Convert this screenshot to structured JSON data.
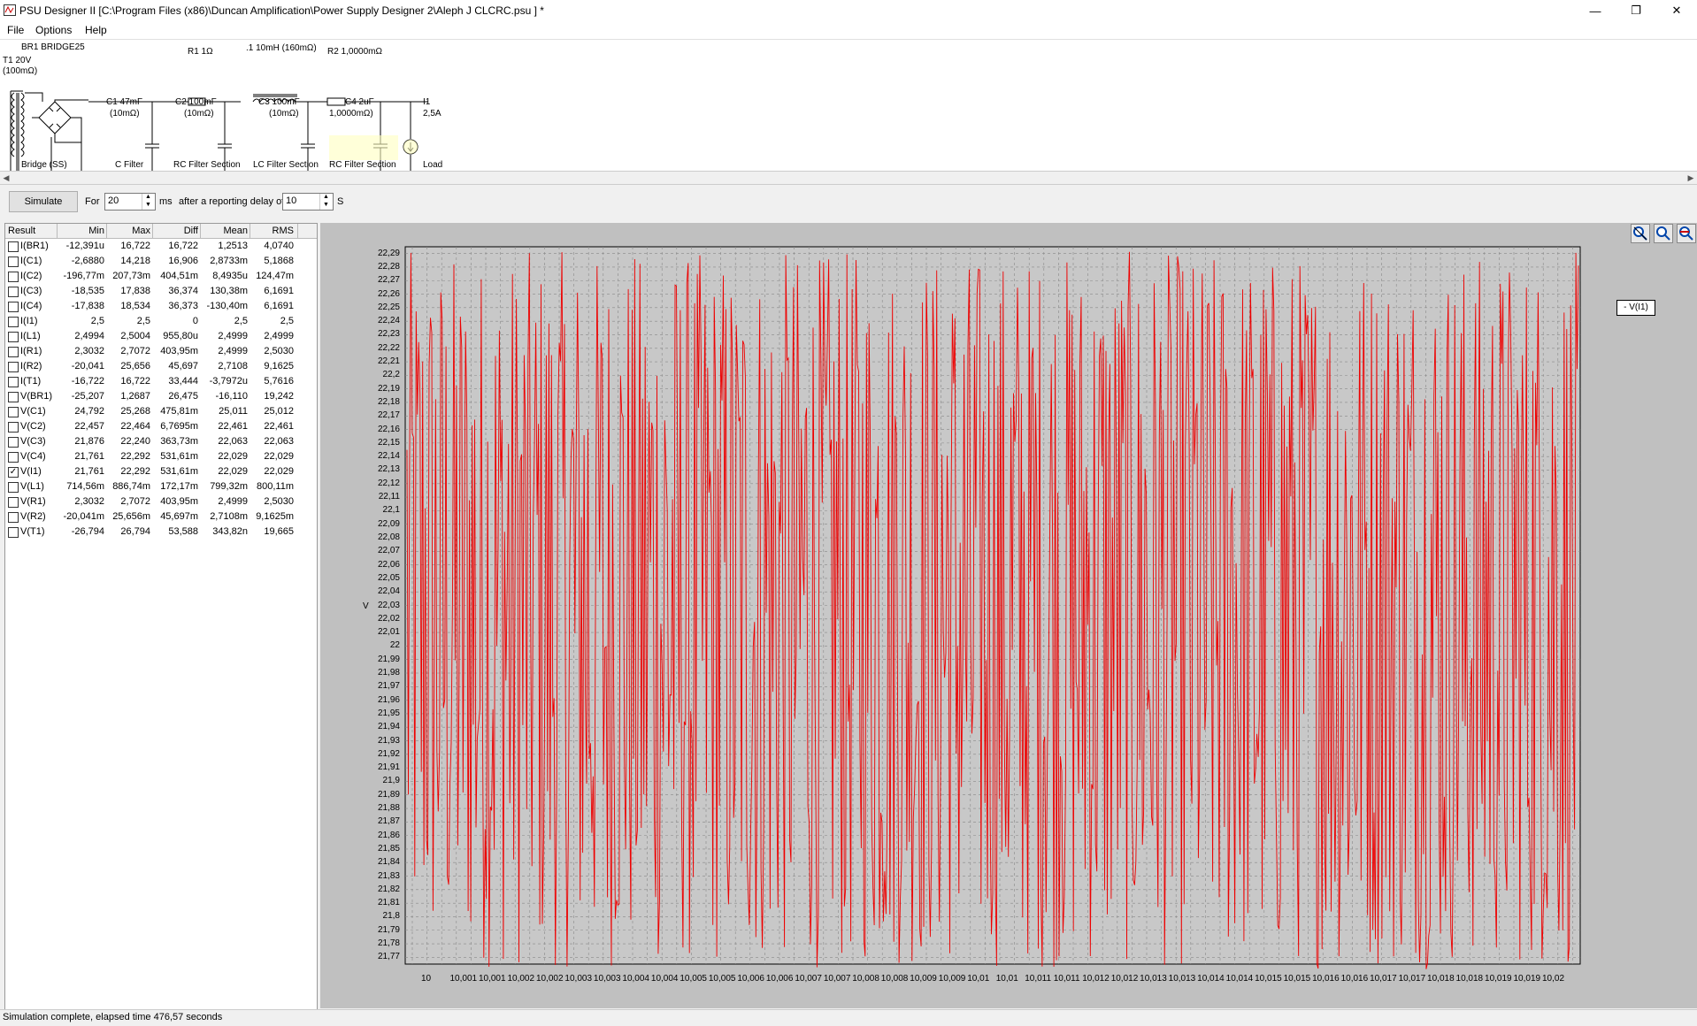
{
  "window": {
    "title": "PSU Designer II  [C:\\Program Files (x86)\\Duncan Amplification\\Power Supply Designer 2\\Aleph J CLCRC.psu ] *",
    "minimize_glyph": "—",
    "maximize_glyph": "❐",
    "close_glyph": "✕"
  },
  "menu": [
    "File",
    "Options",
    "Help"
  ],
  "schematic": {
    "labels": {
      "br1": "BR1 BRIDGE25",
      "t1_a": "T1 20V",
      "t1_b": "(100mΩ)",
      "r1": "R1 1Ω",
      "l1": ".1 10mH (160mΩ)",
      "r2": "R2 1,0000mΩ",
      "c1_a": "C1 47mF",
      "c1_b": "(10mΩ)",
      "c2_a": "C2 100mF",
      "c2_b": "(10mΩ)",
      "c3_a": "C3 100mF",
      "c3_b": "(10mΩ)",
      "c4_a": "C4 2uF",
      "c4_b": "1,0000mΩ)",
      "i1_a": "I1",
      "i1_b": "2,5A"
    },
    "sections": {
      "bridge": "Bridge (SS)",
      "cfilter": "C Filter",
      "rc1": "RC Filter Section",
      "lc": "LC Filter Section",
      "rc2": "RC Filter Section",
      "load": "Load"
    }
  },
  "simbar": {
    "simulate_label": "Simulate",
    "for_label": "For",
    "duration_value": "20",
    "ms_label": "ms",
    "after_label": "after a reporting delay of",
    "delay_value": "10",
    "s_label": "S"
  },
  "results": {
    "headers": [
      "Result",
      "Min",
      "Max",
      "Diff",
      "Mean",
      "RMS"
    ],
    "rows": [
      {
        "name": "I(BR1)",
        "checked": false,
        "min": "-12,391u",
        "max": "16,722",
        "diff": "16,722",
        "mean": "1,2513",
        "rms": "4,0740"
      },
      {
        "name": "I(C1)",
        "checked": false,
        "min": "-2,6880",
        "max": "14,218",
        "diff": "16,906",
        "mean": "2,8733m",
        "rms": "5,1868"
      },
      {
        "name": "I(C2)",
        "checked": false,
        "min": "-196,77m",
        "max": "207,73m",
        "diff": "404,51m",
        "mean": "8,4935u",
        "rms": "124,47m"
      },
      {
        "name": "I(C3)",
        "checked": false,
        "min": "-18,535",
        "max": "17,838",
        "diff": "36,374",
        "mean": "130,38m",
        "rms": "6,1691"
      },
      {
        "name": "I(C4)",
        "checked": false,
        "min": "-17,838",
        "max": "18,534",
        "diff": "36,373",
        "mean": "-130,40m",
        "rms": "6,1691"
      },
      {
        "name": "I(I1)",
        "checked": false,
        "min": "2,5",
        "max": "2,5",
        "diff": "0",
        "mean": "2,5",
        "rms": "2,5"
      },
      {
        "name": "I(L1)",
        "checked": false,
        "min": "2,4994",
        "max": "2,5004",
        "diff": "955,80u",
        "mean": "2,4999",
        "rms": "2,4999"
      },
      {
        "name": "I(R1)",
        "checked": false,
        "min": "2,3032",
        "max": "2,7072",
        "diff": "403,95m",
        "mean": "2,4999",
        "rms": "2,5030"
      },
      {
        "name": "I(R2)",
        "checked": false,
        "min": "-20,041",
        "max": "25,656",
        "diff": "45,697",
        "mean": "2,7108",
        "rms": "9,1625"
      },
      {
        "name": "I(T1)",
        "checked": false,
        "min": "-16,722",
        "max": "16,722",
        "diff": "33,444",
        "mean": "-3,7972u",
        "rms": "5,7616"
      },
      {
        "name": "V(BR1)",
        "checked": false,
        "min": "-25,207",
        "max": "1,2687",
        "diff": "26,475",
        "mean": "-16,110",
        "rms": "19,242"
      },
      {
        "name": "V(C1)",
        "checked": false,
        "min": "24,792",
        "max": "25,268",
        "diff": "475,81m",
        "mean": "25,011",
        "rms": "25,012"
      },
      {
        "name": "V(C2)",
        "checked": false,
        "min": "22,457",
        "max": "22,464",
        "diff": "6,7695m",
        "mean": "22,461",
        "rms": "22,461"
      },
      {
        "name": "V(C3)",
        "checked": false,
        "min": "21,876",
        "max": "22,240",
        "diff": "363,73m",
        "mean": "22,063",
        "rms": "22,063"
      },
      {
        "name": "V(C4)",
        "checked": false,
        "min": "21,761",
        "max": "22,292",
        "diff": "531,61m",
        "mean": "22,029",
        "rms": "22,029"
      },
      {
        "name": "V(I1)",
        "checked": true,
        "min": "21,761",
        "max": "22,292",
        "diff": "531,61m",
        "mean": "22,029",
        "rms": "22,029"
      },
      {
        "name": "V(L1)",
        "checked": false,
        "min": "714,56m",
        "max": "886,74m",
        "diff": "172,17m",
        "mean": "799,32m",
        "rms": "800,11m"
      },
      {
        "name": "V(R1)",
        "checked": false,
        "min": "2,3032",
        "max": "2,7072",
        "diff": "403,95m",
        "mean": "2,4999",
        "rms": "2,5030"
      },
      {
        "name": "V(R2)",
        "checked": false,
        "min": "-20,041m",
        "max": "25,656m",
        "diff": "45,697m",
        "mean": "2,7108m",
        "rms": "9,1625m"
      },
      {
        "name": "V(T1)",
        "checked": false,
        "min": "-26,794",
        "max": "26,794",
        "diff": "53,588",
        "mean": "343,82n",
        "rms": "19,665"
      }
    ]
  },
  "plot_tools": [
    "zoom-in-icon",
    "zoom-icon",
    "zoom-out-icon"
  ],
  "legend": "- V(I1)",
  "colors": {
    "trace": "#ee0000",
    "plot_bg": "#c0c0c0",
    "chart_area": "#c8c8c8"
  },
  "chart_data": {
    "type": "line",
    "series": [
      {
        "name": "V(I1)",
        "color": "#ee0000"
      }
    ],
    "ylabel": "V",
    "ylim": [
      21.765,
      22.295
    ],
    "yticks": [
      "22,29",
      "22,28",
      "22,27",
      "22,26",
      "22,25",
      "22,24",
      "22,23",
      "22,22",
      "22,21",
      "22,2",
      "22,19",
      "22,18",
      "22,17",
      "22,16",
      "22,15",
      "22,14",
      "22,13",
      "22,12",
      "22,11",
      "22,1",
      "22,09",
      "22,08",
      "22,07",
      "22,06",
      "22,05",
      "22,04",
      "22,03",
      "22,02",
      "22,01",
      "22",
      "21,99",
      "21,98",
      "21,97",
      "21,96",
      "21,95",
      "21,94",
      "21,93",
      "21,92",
      "21,91",
      "21,9",
      "21,89",
      "21,88",
      "21,87",
      "21,86",
      "21,85",
      "21,84",
      "21,83",
      "21,82",
      "21,81",
      "21,8",
      "21,79",
      "21,78",
      "21,77"
    ],
    "xticks": [
      "10",
      "10,001",
      "10,001",
      "10,002",
      "10,002",
      "10,003",
      "10,003",
      "10,004",
      "10,004",
      "10,005",
      "10,005",
      "10,006",
      "10,006",
      "10,007",
      "10,007",
      "10,008",
      "10,008",
      "10,009",
      "10,009",
      "10,01",
      "10,01",
      "10,011",
      "10,011",
      "10,012",
      "10,012",
      "10,013",
      "10,013",
      "10,014",
      "10,014",
      "10,015",
      "10,015",
      "10,016",
      "10,016",
      "10,017",
      "10,017",
      "10,018",
      "10,018",
      "10,019",
      "10,019",
      "10,02"
    ],
    "grid": true,
    "legend": "top-right",
    "y_extent": {
      "min": 21.761,
      "max": 22.292,
      "mean": 22.029
    }
  },
  "status": "Simulation complete, elapsed time 476,57 seconds"
}
